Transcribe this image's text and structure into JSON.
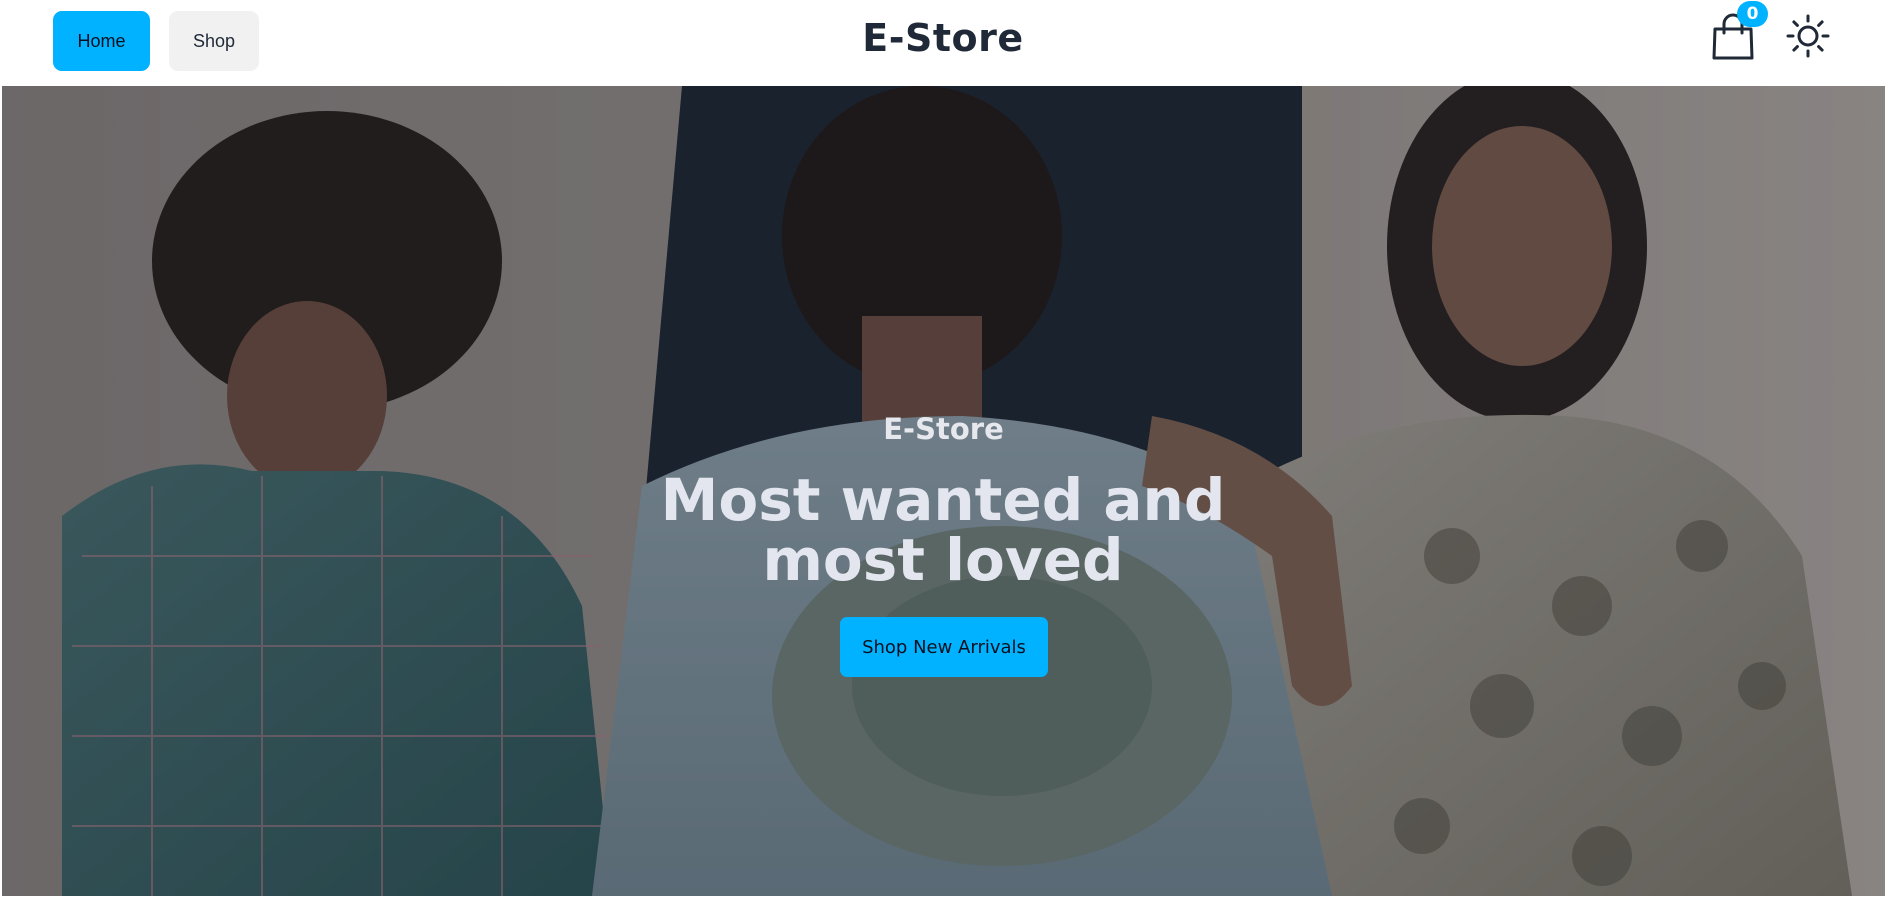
{
  "header": {
    "nav": [
      {
        "label": "Home"
      },
      {
        "label": "Shop"
      }
    ],
    "brand": "E-Store",
    "cart": {
      "icon": "shopping-bag-icon",
      "count": "0"
    },
    "theme_toggle": {
      "icon": "sun-icon"
    }
  },
  "hero": {
    "kicker": "E-Store",
    "title_line1": "Most wanted and",
    "title_line2": "most loved",
    "cta_label": "Shop New Arrivals"
  },
  "colors": {
    "accent": "#00b2ff",
    "text_dark": "#1f2937",
    "nav_inactive_bg": "#f1f1f1",
    "hero_text": "#e3e6ee"
  }
}
